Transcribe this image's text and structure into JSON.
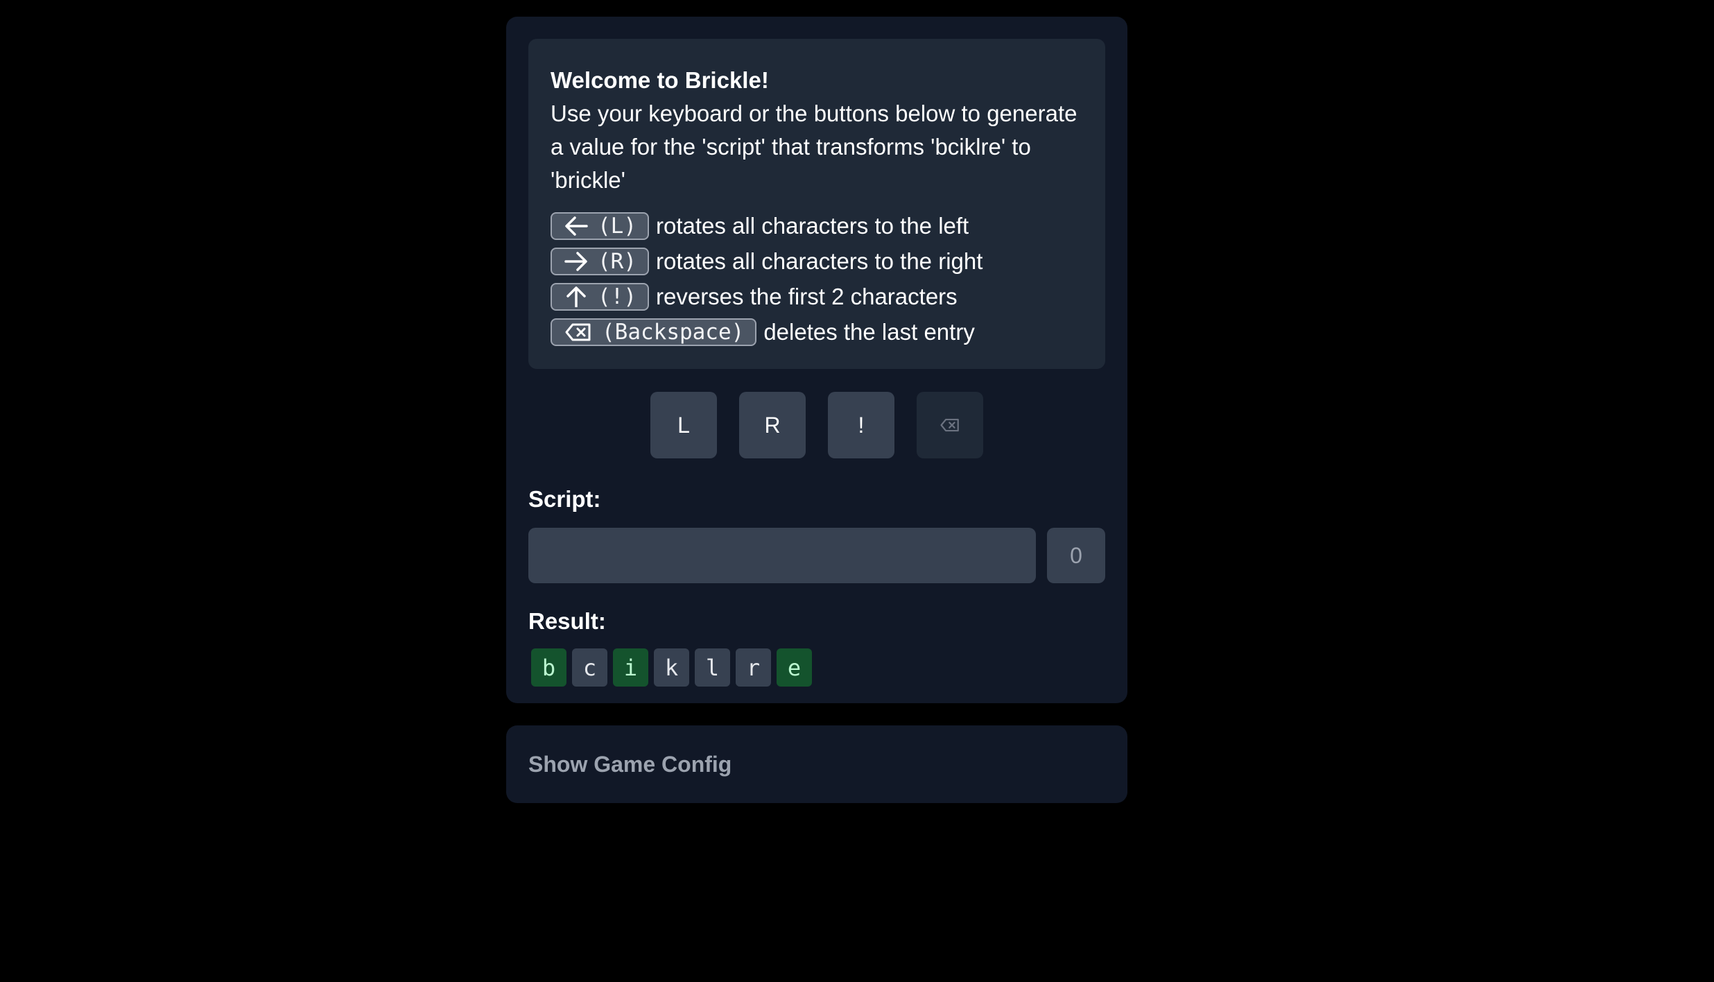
{
  "intro": {
    "title": "Welcome to Brickle!",
    "text": "Use your keyboard or the buttons below to generate a value for the 'script' that transforms 'bciklre' to 'brickle'"
  },
  "rules": [
    {
      "icon": "arrow-left-icon",
      "key": "(L)",
      "description": "rotates all characters to the left"
    },
    {
      "icon": "arrow-right-icon",
      "key": "(R)",
      "description": "rotates all characters to the right"
    },
    {
      "icon": "arrow-up-icon",
      "key": "(!)",
      "description": "reverses the first 2 characters"
    },
    {
      "icon": "backspace-icon",
      "key": "(Backspace)",
      "description": "deletes the last entry"
    }
  ],
  "controls": {
    "left_label": "L",
    "right_label": "R",
    "reverse_label": "!",
    "backspace_icon": "backspace-icon"
  },
  "script": {
    "label": "Script:",
    "value": "",
    "count": "0"
  },
  "result": {
    "label": "Result:",
    "tiles": [
      {
        "char": "b",
        "correct": true
      },
      {
        "char": "c",
        "correct": false
      },
      {
        "char": "i",
        "correct": true
      },
      {
        "char": "k",
        "correct": false
      },
      {
        "char": "l",
        "correct": false
      },
      {
        "char": "r",
        "correct": false
      },
      {
        "char": "e",
        "correct": true
      }
    ]
  },
  "config": {
    "toggle_label": "Show Game Config"
  },
  "colors": {
    "background": "#000000",
    "card": "#111827",
    "panel": "#1f2937",
    "button": "#374151",
    "correct_tile": "#14532d",
    "correct_text": "#bbf7d0"
  }
}
